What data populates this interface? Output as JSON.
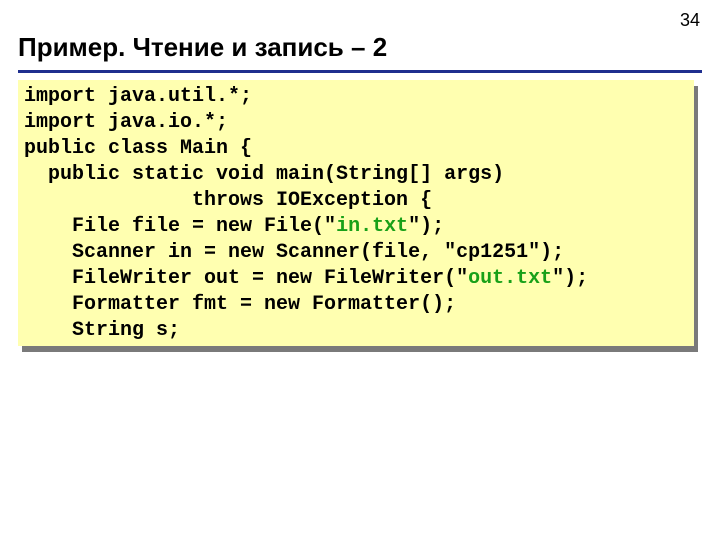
{
  "page_number": "34",
  "title": "Пример. Чтение и запись – 2",
  "code": {
    "l1": "import java.util.*;",
    "l2": "import java.io.*;",
    "l3": "public class Main {",
    "l4": "  public static void main(String[] args)",
    "l5": "              throws IOException {",
    "l6a": "    File file = new File(\"",
    "l6b": "in.txt",
    "l6c": "\");",
    "l7": "    Scanner in = new Scanner(file, \"cp1251\");",
    "l8a": "    FileWriter out = new FileWriter(\"",
    "l8b": "out.txt",
    "l8c": "\");",
    "l9": "    Formatter fmt = new Formatter();",
    "l10": "    String s;"
  }
}
